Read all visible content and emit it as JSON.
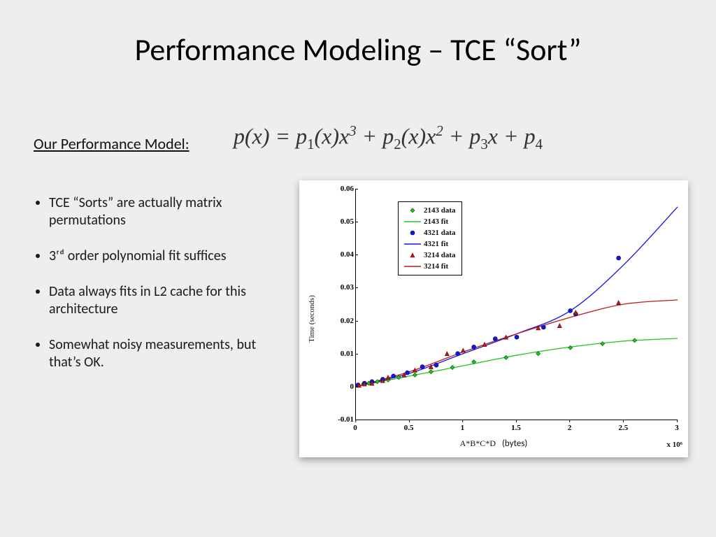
{
  "title": "Performance Modeling – TCE “Sort”",
  "model_label": "Our Performance Model:",
  "formula_html": "p(x) = p<sub>1</sub>(x)x<sup>3</sup> + p<sub>2</sub>(x)x<sup>2</sup> + p<sub>3</sub>x + p<sub>4</sub>",
  "bullets": [
    "TCE “Sorts” are actually matrix permutations",
    "3ʳᵈ order polynomial fit suffices",
    "Data always fits in L2 cache for this architecture",
    "Somewhat noisy measurements, but that’s OK."
  ],
  "chart_data": {
    "type": "scatter+line",
    "xlabel": "A*B*C*D",
    "xlabel_extra": "(bytes)",
    "ylabel": "Time (seconds)",
    "xlim": [
      0,
      3.0
    ],
    "ylim": [
      -0.01,
      0.06
    ],
    "xticks": [
      0,
      0.5,
      1.0,
      1.5,
      2.0,
      2.5,
      3.0
    ],
    "yticks": [
      -0.01,
      0,
      0.01,
      0.02,
      0.03,
      0.04,
      0.05,
      0.06
    ],
    "x_multiplier_label": "x 10⁶",
    "legend": [
      {
        "key": "2143_data",
        "label": "2143 data",
        "type": "marker",
        "shape": "diamond",
        "color": "#1ec71e"
      },
      {
        "key": "2143_fit",
        "label": "2143 fit",
        "type": "line",
        "color": "#1ec71e"
      },
      {
        "key": "4321_data",
        "label": "4321 data",
        "type": "marker",
        "shape": "circle",
        "color": "#1414e6"
      },
      {
        "key": "4321_fit",
        "label": "4321 fit",
        "type": "line",
        "color": "#1414e6"
      },
      {
        "key": "3214_data",
        "label": "3214 data",
        "type": "marker",
        "shape": "triangle",
        "color": "#c01818"
      },
      {
        "key": "3214_fit",
        "label": "3214 fit",
        "type": "line",
        "color": "#c01818"
      }
    ],
    "series": {
      "2143_data": [
        [
          0.02,
          0.0003
        ],
        [
          0.07,
          0.0008
        ],
        [
          0.12,
          0.001
        ],
        [
          0.2,
          0.0015
        ],
        [
          0.3,
          0.002
        ],
        [
          0.4,
          0.0028
        ],
        [
          0.55,
          0.0035
        ],
        [
          0.7,
          0.0045
        ],
        [
          0.9,
          0.0058
        ],
        [
          1.1,
          0.0075
        ],
        [
          1.4,
          0.0088
        ],
        [
          1.7,
          0.01
        ],
        [
          2.0,
          0.0118
        ],
        [
          2.3,
          0.013
        ],
        [
          2.6,
          0.014
        ]
      ],
      "4321_data": [
        [
          0.02,
          0.0005
        ],
        [
          0.08,
          0.001
        ],
        [
          0.15,
          0.0015
        ],
        [
          0.25,
          0.0022
        ],
        [
          0.35,
          0.0032
        ],
        [
          0.48,
          0.0042
        ],
        [
          0.62,
          0.006
        ],
        [
          0.75,
          0.0065
        ],
        [
          0.95,
          0.01
        ],
        [
          1.1,
          0.012
        ],
        [
          1.3,
          0.0145
        ],
        [
          1.5,
          0.015
        ],
        [
          1.75,
          0.018
        ],
        [
          2.0,
          0.023
        ],
        [
          2.05,
          0.022
        ],
        [
          2.45,
          0.039
        ]
      ],
      "3214_data": [
        [
          0.03,
          0.0004
        ],
        [
          0.08,
          0.0008
        ],
        [
          0.15,
          0.001
        ],
        [
          0.25,
          0.0018
        ],
        [
          0.3,
          0.0028
        ],
        [
          0.45,
          0.0035
        ],
        [
          0.55,
          0.005
        ],
        [
          0.7,
          0.006
        ],
        [
          0.85,
          0.01
        ],
        [
          1.0,
          0.011
        ],
        [
          1.2,
          0.0128
        ],
        [
          1.4,
          0.015
        ],
        [
          1.7,
          0.0178
        ],
        [
          1.9,
          0.0185
        ],
        [
          2.05,
          0.0225
        ],
        [
          2.45,
          0.0255
        ]
      ],
      "2143_fit": [
        [
          0,
          0
        ],
        [
          0.5,
          0.0032
        ],
        [
          1.0,
          0.0063
        ],
        [
          1.5,
          0.0095
        ],
        [
          2.0,
          0.012
        ],
        [
          2.5,
          0.0138
        ],
        [
          3.0,
          0.0146
        ]
      ],
      "4321_fit": [
        [
          0,
          0
        ],
        [
          0.5,
          0.004
        ],
        [
          1.0,
          0.01
        ],
        [
          1.5,
          0.016
        ],
        [
          2.0,
          0.023
        ],
        [
          2.5,
          0.037
        ],
        [
          3.0,
          0.0545
        ]
      ],
      "3214_fit": [
        [
          0,
          0
        ],
        [
          0.5,
          0.0045
        ],
        [
          1.0,
          0.0105
        ],
        [
          1.5,
          0.016
        ],
        [
          2.0,
          0.021
        ],
        [
          2.5,
          0.025
        ],
        [
          3.0,
          0.0263
        ]
      ]
    }
  }
}
